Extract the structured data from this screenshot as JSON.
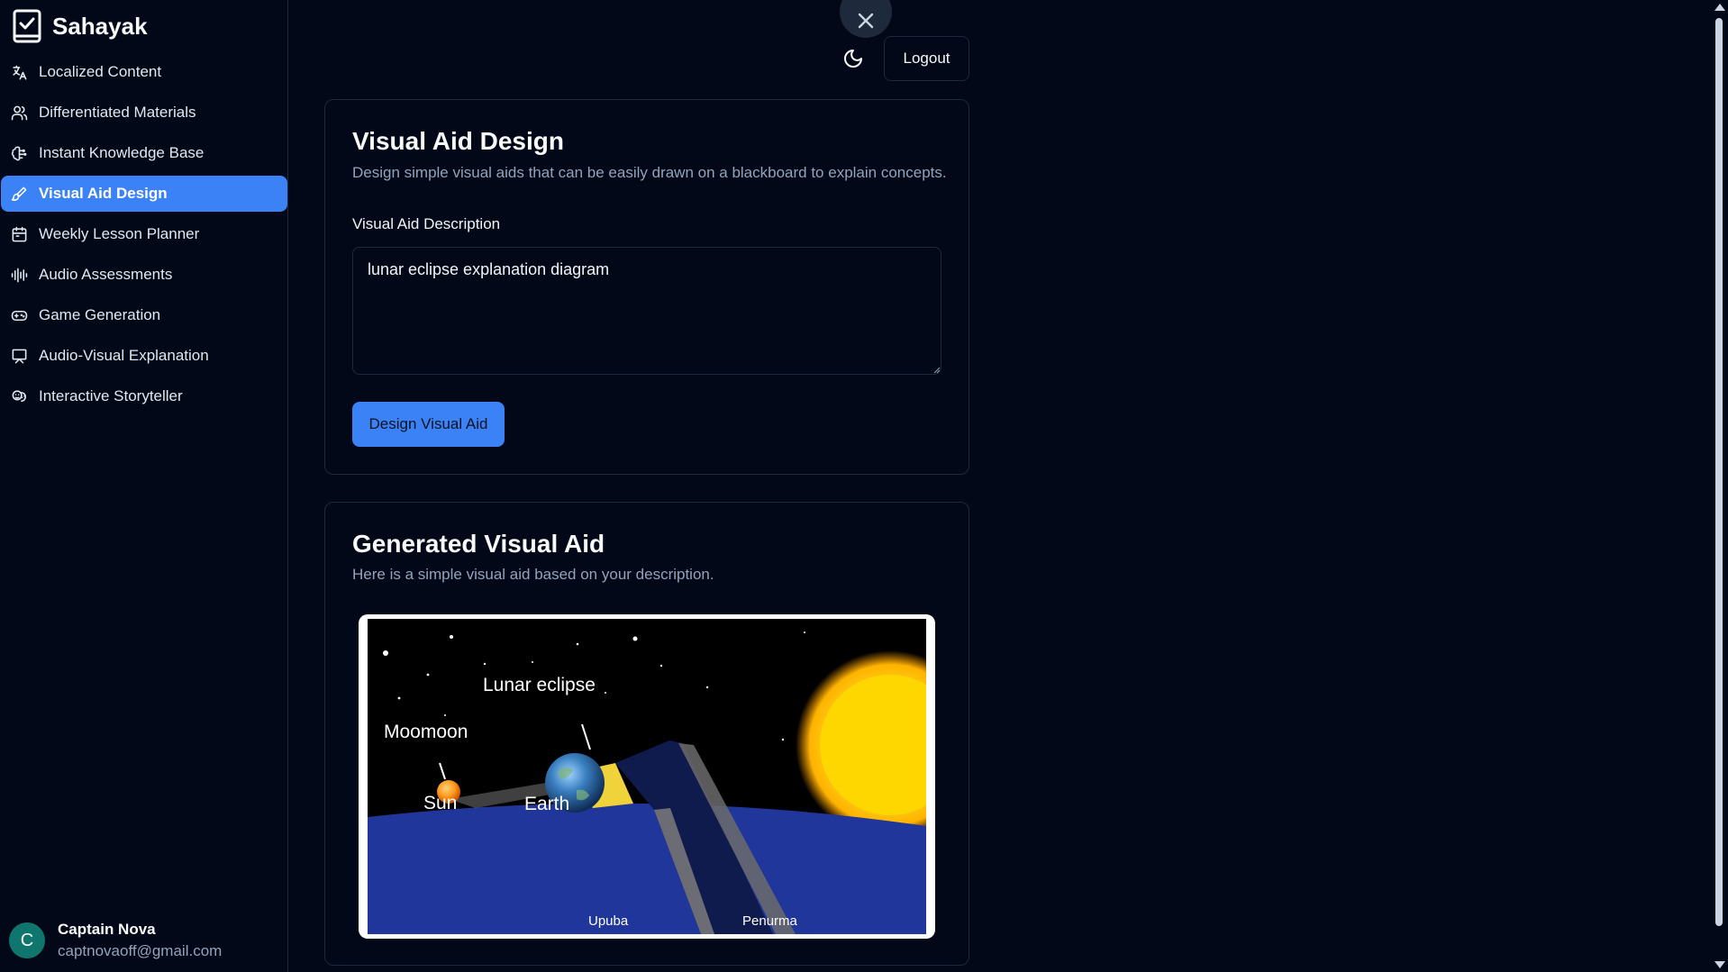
{
  "app": {
    "name": "Sahayak"
  },
  "sidebar": {
    "items": [
      {
        "label": "Localized Content",
        "icon": "languages-icon",
        "active": false
      },
      {
        "label": "Differentiated Materials",
        "icon": "users-icon",
        "active": false
      },
      {
        "label": "Instant Knowledge Base",
        "icon": "brain-icon",
        "active": false
      },
      {
        "label": "Visual Aid Design",
        "icon": "brush-icon",
        "active": true
      },
      {
        "label": "Weekly Lesson Planner",
        "icon": "calendar-icon",
        "active": false
      },
      {
        "label": "Audio Assessments",
        "icon": "audio-lines-icon",
        "active": false
      },
      {
        "label": "Game Generation",
        "icon": "gamepad-icon",
        "active": false
      },
      {
        "label": "Audio-Visual Explanation",
        "icon": "presentation-icon",
        "active": false
      },
      {
        "label": "Interactive Storyteller",
        "icon": "drama-icon",
        "active": false
      }
    ]
  },
  "user": {
    "initial": "C",
    "name": "Captain Nova",
    "email": "captnovaoff@gmail.com"
  },
  "header": {
    "logout_label": "Logout"
  },
  "design_card": {
    "title": "Visual Aid Design",
    "description": "Design simple visual aids that can be easily drawn on a blackboard to explain concepts.",
    "field_label": "Visual Aid Description",
    "field_value": "lunar eclipse explanation diagram",
    "button_label": "Design Visual Aid"
  },
  "result_card": {
    "title": "Generated Visual Aid",
    "description": "Here is a simple visual aid based on your description.",
    "image_labels": {
      "lunar_eclipse": "Lunar eclipse",
      "moon": "Moomoon",
      "sun": "Sun",
      "earth": "Earth",
      "umbra": "Upuba",
      "penumbra": "Penurma"
    }
  },
  "colors": {
    "background": "#020817",
    "accent": "#3b82f6",
    "border": "#1e293b",
    "muted_text": "#94a3b8"
  }
}
